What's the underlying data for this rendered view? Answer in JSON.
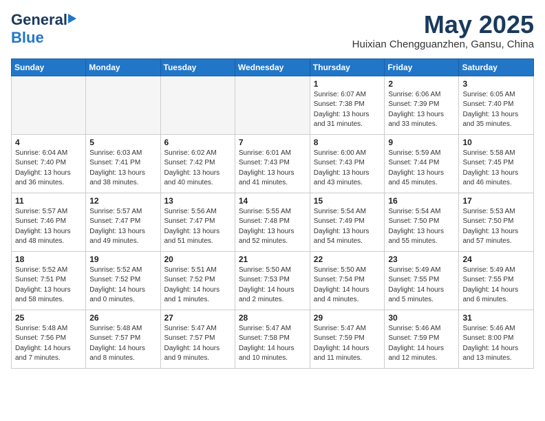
{
  "header": {
    "logo_general": "General",
    "logo_blue": "Blue",
    "month_year": "May 2025",
    "location": "Huixian Chengguanzhen, Gansu, China"
  },
  "days_of_week": [
    "Sunday",
    "Monday",
    "Tuesday",
    "Wednesday",
    "Thursday",
    "Friday",
    "Saturday"
  ],
  "weeks": [
    [
      {
        "day": "",
        "info": ""
      },
      {
        "day": "",
        "info": ""
      },
      {
        "day": "",
        "info": ""
      },
      {
        "day": "",
        "info": ""
      },
      {
        "day": "1",
        "info": "Sunrise: 6:07 AM\nSunset: 7:38 PM\nDaylight: 13 hours\nand 31 minutes."
      },
      {
        "day": "2",
        "info": "Sunrise: 6:06 AM\nSunset: 7:39 PM\nDaylight: 13 hours\nand 33 minutes."
      },
      {
        "day": "3",
        "info": "Sunrise: 6:05 AM\nSunset: 7:40 PM\nDaylight: 13 hours\nand 35 minutes."
      }
    ],
    [
      {
        "day": "4",
        "info": "Sunrise: 6:04 AM\nSunset: 7:40 PM\nDaylight: 13 hours\nand 36 minutes."
      },
      {
        "day": "5",
        "info": "Sunrise: 6:03 AM\nSunset: 7:41 PM\nDaylight: 13 hours\nand 38 minutes."
      },
      {
        "day": "6",
        "info": "Sunrise: 6:02 AM\nSunset: 7:42 PM\nDaylight: 13 hours\nand 40 minutes."
      },
      {
        "day": "7",
        "info": "Sunrise: 6:01 AM\nSunset: 7:43 PM\nDaylight: 13 hours\nand 41 minutes."
      },
      {
        "day": "8",
        "info": "Sunrise: 6:00 AM\nSunset: 7:43 PM\nDaylight: 13 hours\nand 43 minutes."
      },
      {
        "day": "9",
        "info": "Sunrise: 5:59 AM\nSunset: 7:44 PM\nDaylight: 13 hours\nand 45 minutes."
      },
      {
        "day": "10",
        "info": "Sunrise: 5:58 AM\nSunset: 7:45 PM\nDaylight: 13 hours\nand 46 minutes."
      }
    ],
    [
      {
        "day": "11",
        "info": "Sunrise: 5:57 AM\nSunset: 7:46 PM\nDaylight: 13 hours\nand 48 minutes."
      },
      {
        "day": "12",
        "info": "Sunrise: 5:57 AM\nSunset: 7:47 PM\nDaylight: 13 hours\nand 49 minutes."
      },
      {
        "day": "13",
        "info": "Sunrise: 5:56 AM\nSunset: 7:47 PM\nDaylight: 13 hours\nand 51 minutes."
      },
      {
        "day": "14",
        "info": "Sunrise: 5:55 AM\nSunset: 7:48 PM\nDaylight: 13 hours\nand 52 minutes."
      },
      {
        "day": "15",
        "info": "Sunrise: 5:54 AM\nSunset: 7:49 PM\nDaylight: 13 hours\nand 54 minutes."
      },
      {
        "day": "16",
        "info": "Sunrise: 5:54 AM\nSunset: 7:50 PM\nDaylight: 13 hours\nand 55 minutes."
      },
      {
        "day": "17",
        "info": "Sunrise: 5:53 AM\nSunset: 7:50 PM\nDaylight: 13 hours\nand 57 minutes."
      }
    ],
    [
      {
        "day": "18",
        "info": "Sunrise: 5:52 AM\nSunset: 7:51 PM\nDaylight: 13 hours\nand 58 minutes."
      },
      {
        "day": "19",
        "info": "Sunrise: 5:52 AM\nSunset: 7:52 PM\nDaylight: 14 hours\nand 0 minutes."
      },
      {
        "day": "20",
        "info": "Sunrise: 5:51 AM\nSunset: 7:52 PM\nDaylight: 14 hours\nand 1 minutes."
      },
      {
        "day": "21",
        "info": "Sunrise: 5:50 AM\nSunset: 7:53 PM\nDaylight: 14 hours\nand 2 minutes."
      },
      {
        "day": "22",
        "info": "Sunrise: 5:50 AM\nSunset: 7:54 PM\nDaylight: 14 hours\nand 4 minutes."
      },
      {
        "day": "23",
        "info": "Sunrise: 5:49 AM\nSunset: 7:55 PM\nDaylight: 14 hours\nand 5 minutes."
      },
      {
        "day": "24",
        "info": "Sunrise: 5:49 AM\nSunset: 7:55 PM\nDaylight: 14 hours\nand 6 minutes."
      }
    ],
    [
      {
        "day": "25",
        "info": "Sunrise: 5:48 AM\nSunset: 7:56 PM\nDaylight: 14 hours\nand 7 minutes."
      },
      {
        "day": "26",
        "info": "Sunrise: 5:48 AM\nSunset: 7:57 PM\nDaylight: 14 hours\nand 8 minutes."
      },
      {
        "day": "27",
        "info": "Sunrise: 5:47 AM\nSunset: 7:57 PM\nDaylight: 14 hours\nand 9 minutes."
      },
      {
        "day": "28",
        "info": "Sunrise: 5:47 AM\nSunset: 7:58 PM\nDaylight: 14 hours\nand 10 minutes."
      },
      {
        "day": "29",
        "info": "Sunrise: 5:47 AM\nSunset: 7:59 PM\nDaylight: 14 hours\nand 11 minutes."
      },
      {
        "day": "30",
        "info": "Sunrise: 5:46 AM\nSunset: 7:59 PM\nDaylight: 14 hours\nand 12 minutes."
      },
      {
        "day": "31",
        "info": "Sunrise: 5:46 AM\nSunset: 8:00 PM\nDaylight: 14 hours\nand 13 minutes."
      }
    ]
  ]
}
